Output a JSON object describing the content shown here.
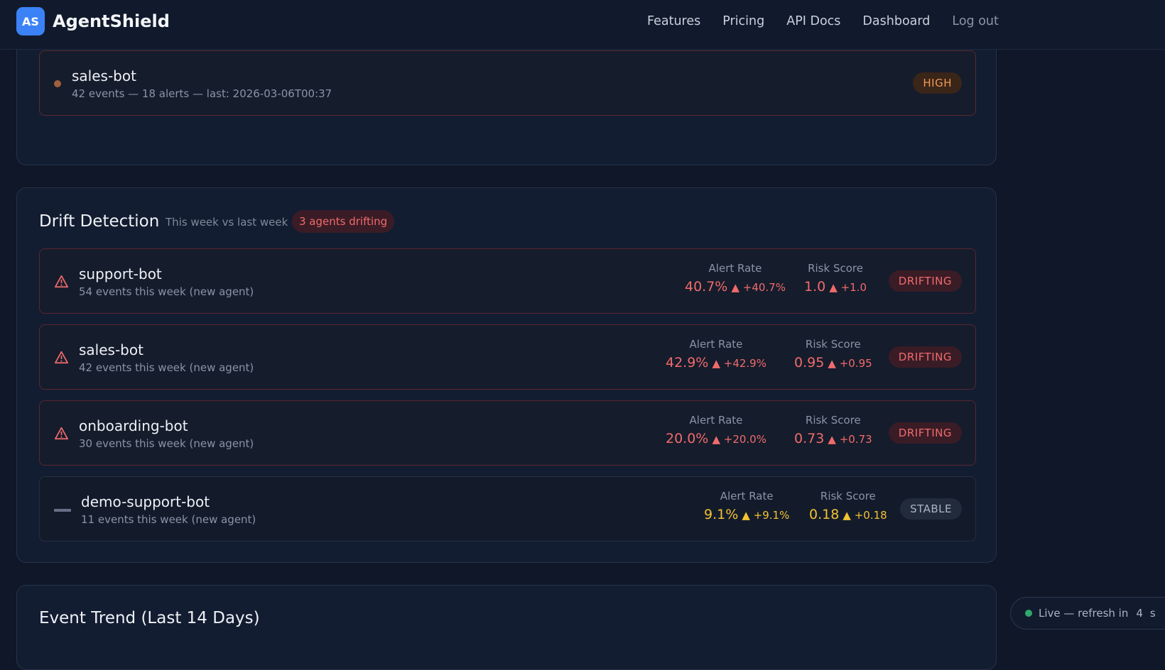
{
  "header": {
    "logo_text": "AS",
    "brand": "AgentShield",
    "nav": [
      "Features",
      "Pricing",
      "API Docs",
      "Dashboard",
      "Log out"
    ]
  },
  "top_card": {
    "row": {
      "name": "sales-bot",
      "sub": "42 events — 18 alerts — last: 2026-03-06T00:37",
      "badge": "HIGH"
    }
  },
  "drift": {
    "title": "Drift Detection",
    "subtitle": "This week vs last week",
    "badge": "3 agents drifting",
    "alert_label": "Alert Rate",
    "risk_label": "Risk Score",
    "agents": [
      {
        "name": "support-bot",
        "sub": "54 events this week (new agent)",
        "alert": "40.7%",
        "alert_delta": "▲ +40.7%",
        "risk": "1.0",
        "risk_delta": "▲ +1.0",
        "status": "DRIFTING"
      },
      {
        "name": "sales-bot",
        "sub": "42 events this week (new agent)",
        "alert": "42.9%",
        "alert_delta": "▲ +42.9%",
        "risk": "0.95",
        "risk_delta": "▲ +0.95",
        "status": "DRIFTING"
      },
      {
        "name": "onboarding-bot",
        "sub": "30 events this week (new agent)",
        "alert": "20.0%",
        "alert_delta": "▲ +20.0%",
        "risk": "0.73",
        "risk_delta": "▲ +0.73",
        "status": "DRIFTING"
      },
      {
        "name": "demo-support-bot",
        "sub": "11 events this week (new agent)",
        "alert": "9.1%",
        "alert_delta": "▲ +9.1%",
        "risk": "0.18",
        "risk_delta": "▲ +0.18",
        "status": "STABLE"
      }
    ]
  },
  "trend": {
    "title": "Event Trend (Last 14 Days)"
  },
  "live": {
    "label": "Live — refresh in",
    "seconds": "4",
    "unit": "s"
  },
  "colors": {
    "accent": "#3b82f6",
    "drift_red": "#f06b6b",
    "stable_yellow": "#f2c233",
    "high_orange": "#f09a52",
    "live_green": "#2ea86b"
  }
}
